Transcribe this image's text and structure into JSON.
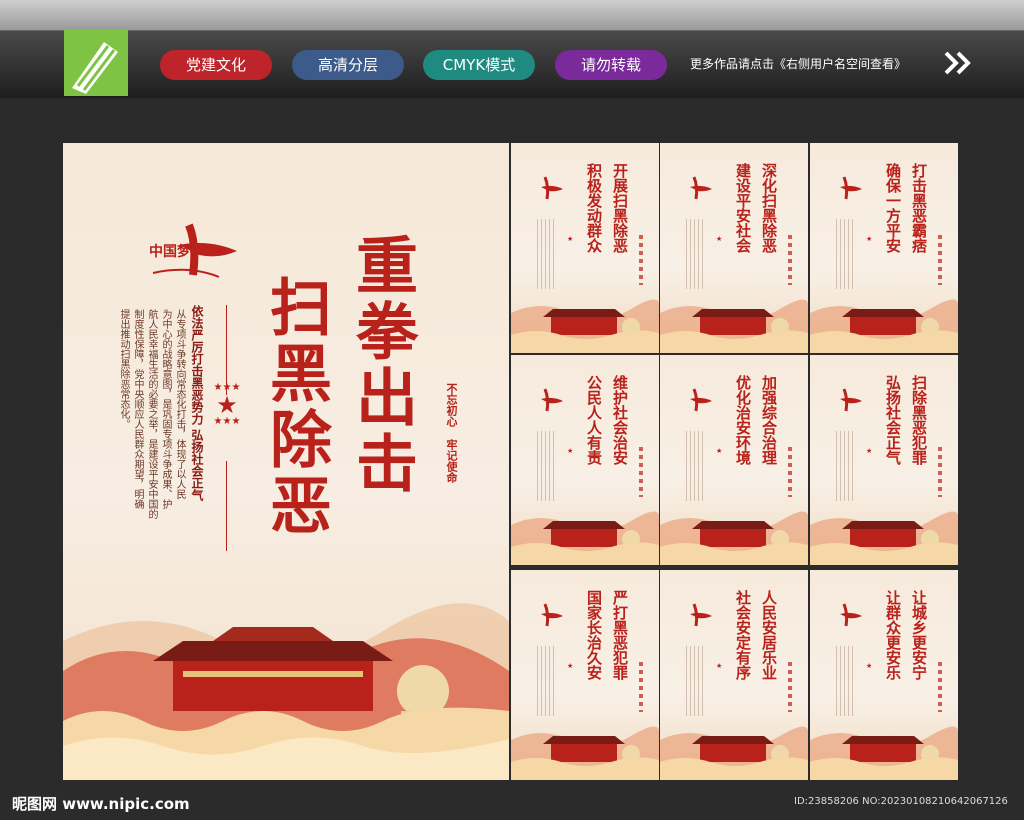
{
  "topbar": {
    "tags": [
      {
        "label": "党建文化",
        "color": "#c0242b"
      },
      {
        "label": "高清分层",
        "color": "#3c5a8a"
      },
      {
        "label": "CMYK模式",
        "color": "#1f8a80"
      },
      {
        "label": "请勿转载",
        "color": "#7a2a9a"
      }
    ],
    "more_text": "更多作品请点击《右侧用户名空间查看》"
  },
  "main_poster": {
    "logo_text": "中国梦",
    "title_line1": "重拳出击",
    "title_line2": "扫黑除恶",
    "slogan_a": "不忘初心",
    "slogan_b": "牢记使命",
    "subtitle": "依法严厉打击黑恶势力 弘扬社会正气",
    "body_col1": "从专项斗争转向常态化打击，体现了以人民",
    "body_col2": "为中心的战略意图，是巩固专项斗争成果、护",
    "body_col3": "航人民幸福生活的必要之举，是建设平安中国的",
    "body_col4": "制度性保障，党中央顺应人民群众期望，明确",
    "body_col5": "提出推动扫黑除恶常态化。"
  },
  "small_posters": [
    {
      "line1": "开展扫黑除恶",
      "line2": "积极发动群众"
    },
    {
      "line1": "深化扫黑除恶",
      "line2": "建设平安社会"
    },
    {
      "line1": "打击黑恶霸痞",
      "line2": "确保一方平安"
    },
    {
      "line1": "维护社会治安",
      "line2": "公民人人有责"
    },
    {
      "line1": "加强综合治理",
      "line2": "优化治安环境"
    },
    {
      "line1": "扫除黑恶犯罪",
      "line2": "弘扬社会正气"
    },
    {
      "line1": "严打黑恶犯罪",
      "line2": "国家长治久安"
    },
    {
      "line1": "人民安居乐业",
      "line2": "社会安定有序"
    },
    {
      "line1": "让城乡更安宁",
      "line2": "让群众更安乐"
    }
  ],
  "footer": {
    "site": "昵图网 www.nipic.com",
    "id_text": "ID:23858206 NO:20230108210642067126"
  }
}
